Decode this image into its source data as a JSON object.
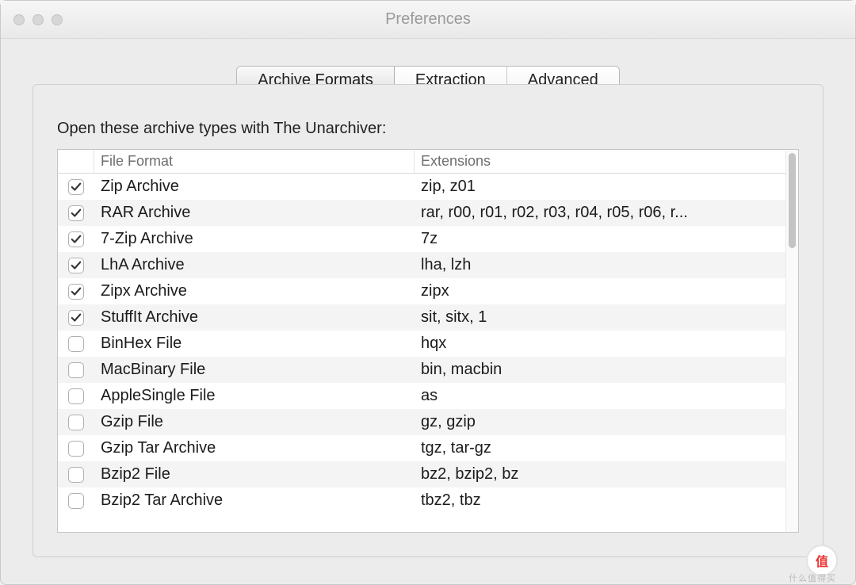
{
  "window": {
    "title": "Preferences"
  },
  "tabs": {
    "archive_formats": "Archive Formats",
    "extraction": "Extraction",
    "advanced": "Advanced",
    "active_index": 0
  },
  "section_label": "Open these archive types with The Unarchiver:",
  "columns": {
    "format": "File Format",
    "extensions": "Extensions"
  },
  "rows": [
    {
      "checked": true,
      "format": "Zip Archive",
      "ext": "zip, z01"
    },
    {
      "checked": true,
      "format": "RAR Archive",
      "ext": "rar, r00, r01, r02, r03, r04, r05, r06, r..."
    },
    {
      "checked": true,
      "format": "7-Zip Archive",
      "ext": "7z"
    },
    {
      "checked": true,
      "format": "LhA Archive",
      "ext": "lha, lzh"
    },
    {
      "checked": true,
      "format": "Zipx Archive",
      "ext": "zipx"
    },
    {
      "checked": true,
      "format": "StuffIt Archive",
      "ext": "sit, sitx, 1"
    },
    {
      "checked": false,
      "format": "BinHex File",
      "ext": "hqx"
    },
    {
      "checked": false,
      "format": "MacBinary File",
      "ext": "bin, macbin"
    },
    {
      "checked": false,
      "format": "AppleSingle File",
      "ext": "as"
    },
    {
      "checked": false,
      "format": "Gzip File",
      "ext": "gz, gzip"
    },
    {
      "checked": false,
      "format": "Gzip Tar Archive",
      "ext": "tgz, tar-gz"
    },
    {
      "checked": false,
      "format": "Bzip2 File",
      "ext": "bz2, bzip2, bz"
    },
    {
      "checked": false,
      "format": "Bzip2 Tar Archive",
      "ext": "tbz2, tbz"
    }
  ],
  "watermark": {
    "badge": "值",
    "text": "什么值得买"
  }
}
